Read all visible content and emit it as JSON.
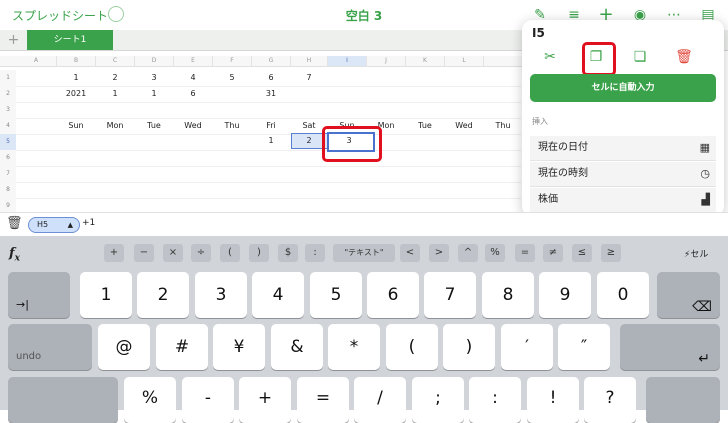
{
  "toolbar": {
    "back_label": "スプレッドシート",
    "title": "空白 3"
  },
  "tabs": {
    "add_label": "+",
    "sheet_label": "シート1"
  },
  "columns": [
    "A",
    "B",
    "C",
    "D",
    "E",
    "F",
    "G",
    "H",
    "I",
    "J",
    "K",
    "L"
  ],
  "rows": [
    "1",
    "2",
    "3",
    "4",
    "5",
    "6",
    "7",
    "8",
    "9"
  ],
  "cells": {
    "row1": [
      "1",
      "2",
      "3",
      "4",
      "5",
      "6",
      "7"
    ],
    "row2": [
      "2021",
      "1",
      "1",
      "6",
      "31"
    ],
    "row4": [
      "Sun",
      "Mon",
      "Tue",
      "Wed",
      "Thu",
      "Fri",
      "Sat",
      "Sun",
      "Mon",
      "Tue",
      "Wed",
      "Thu"
    ],
    "row5": [
      "1",
      "2",
      "3"
    ]
  },
  "popover": {
    "cell_ref": "I5",
    "autofill_label": "セルに自動入力",
    "insert_section": "挿入",
    "items": [
      {
        "label": "現在の日付",
        "icon": "calendar-icon"
      },
      {
        "label": "現在の時刻",
        "icon": "clock-icon"
      },
      {
        "label": "株価",
        "icon": "chart-icon"
      }
    ]
  },
  "formula": {
    "ref": "H5",
    "arrow": "▲",
    "expression": "+1"
  },
  "keyboard": {
    "fx": "f",
    "fx_sub": "x",
    "operators": [
      "+",
      "−",
      "×",
      "÷",
      "(",
      ")",
      "$",
      ":",
      "\"テキスト\"",
      "<",
      ">",
      "^",
      "%",
      "=",
      "≠",
      "≤",
      "≥"
    ],
    "cell_label": "セル",
    "row1": [
      "1",
      "2",
      "3",
      "4",
      "5",
      "6",
      "7",
      "8",
      "9",
      "0"
    ],
    "row2": [
      "@",
      "#",
      "¥",
      "&",
      "*",
      "(",
      ")",
      "′",
      "″"
    ],
    "row3": [
      "%",
      "-",
      "+",
      "=",
      "/",
      ";",
      ":",
      "!",
      "?"
    ],
    "tab_key": "→|",
    "undo_key": "undo",
    "backspace_key": "⌫",
    "return_key": "↵"
  },
  "colors": {
    "accent": "#3aa24a",
    "selection": "#4a73d0",
    "highlight": "#e0101e"
  }
}
